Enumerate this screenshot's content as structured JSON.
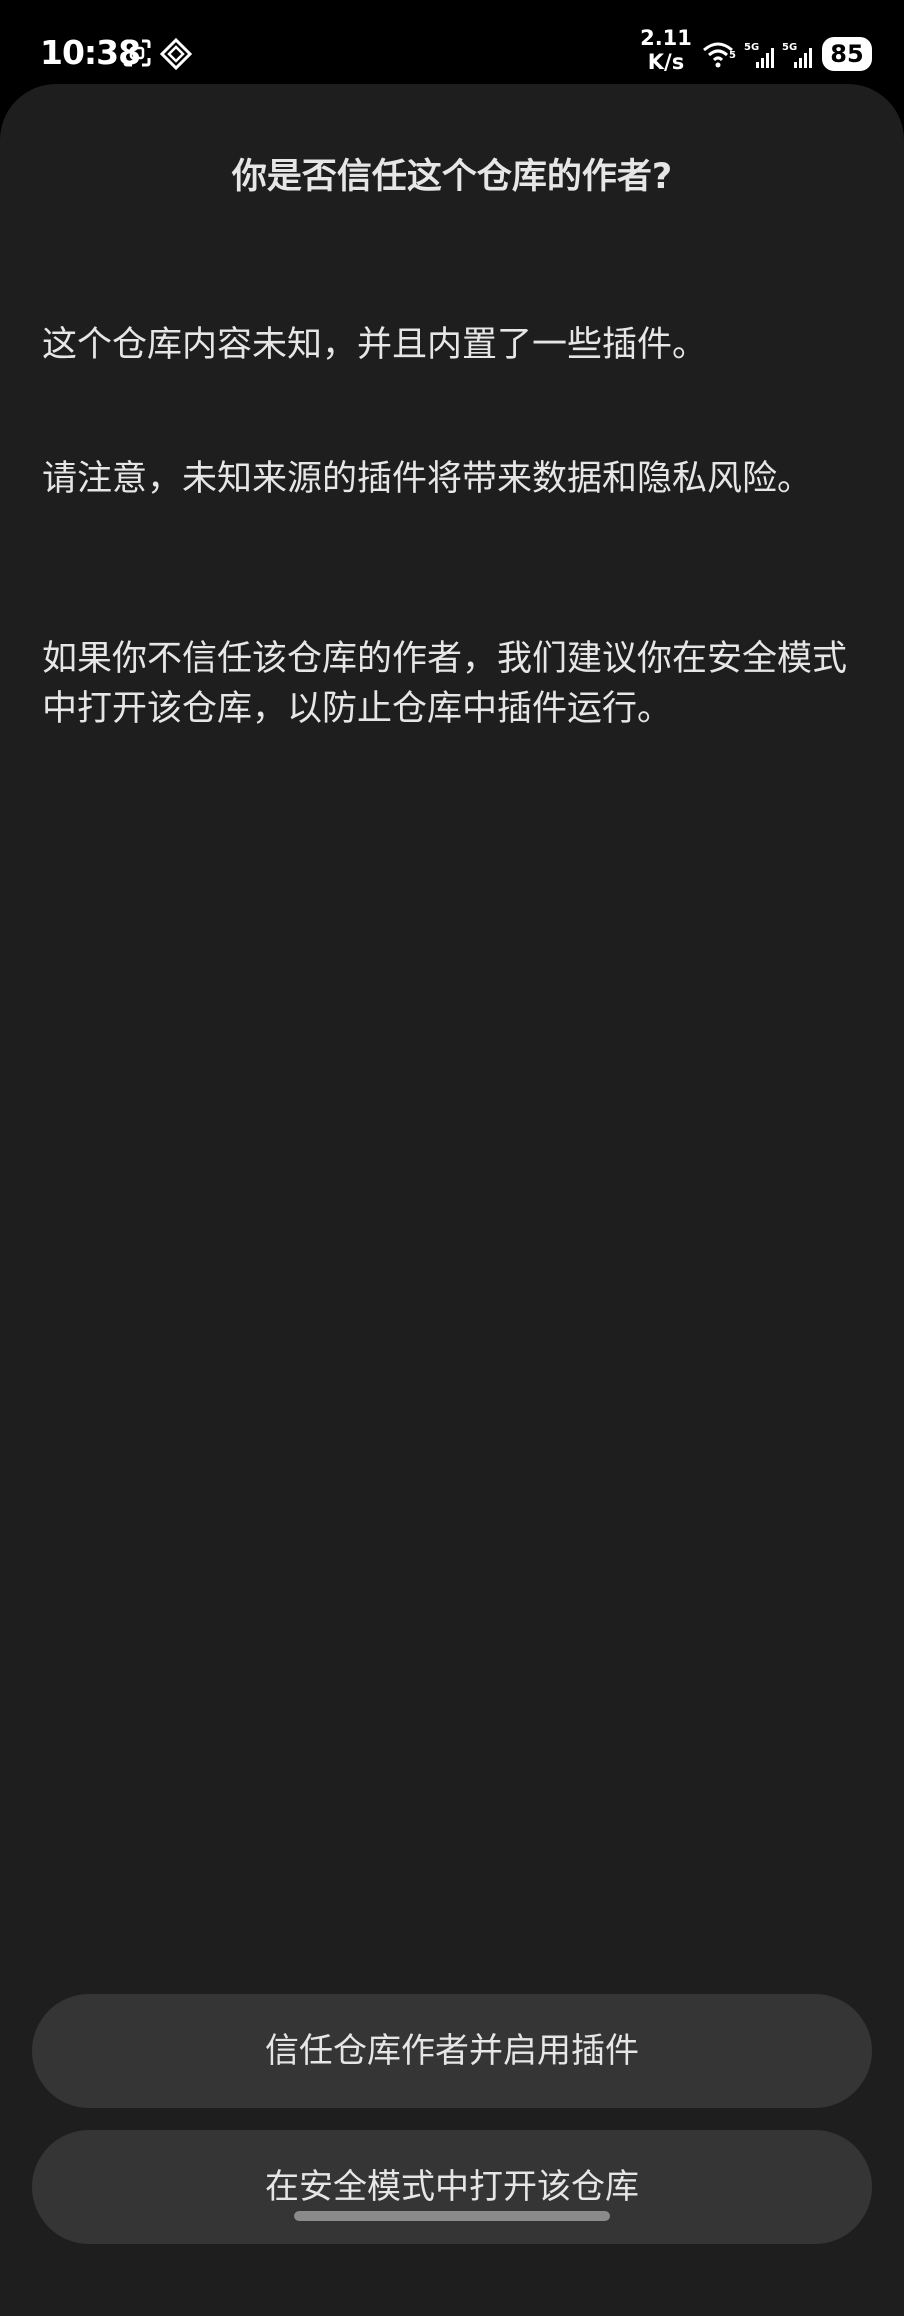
{
  "status_bar": {
    "time": "10:38",
    "net_speed_value": "2.11",
    "net_speed_unit": "K/s",
    "battery": "85",
    "icons": [
      "screenshot-icon",
      "vpn-diamond-icon",
      "wifi-icon",
      "signal-5g-icon",
      "signal-5g-icon-2"
    ]
  },
  "dialog": {
    "title": "你是否信任这个仓库的作者?",
    "paragraphs": [
      "这个仓库内容未知，并且内置了一些插件。",
      "请注意，未知来源的插件将带来数据和隐私风险。",
      "如果你不信任该仓库的作者，我们建议你在安全模式中打开该仓库，以防止仓库中插件运行。"
    ],
    "buttons": {
      "trust": "信任仓库作者并启用插件",
      "safe_mode": "在安全模式中打开该仓库"
    }
  },
  "colors": {
    "background": "#000000",
    "sheet": "#1e1e1e",
    "button": "#353535",
    "text": "#e6e6e6"
  }
}
